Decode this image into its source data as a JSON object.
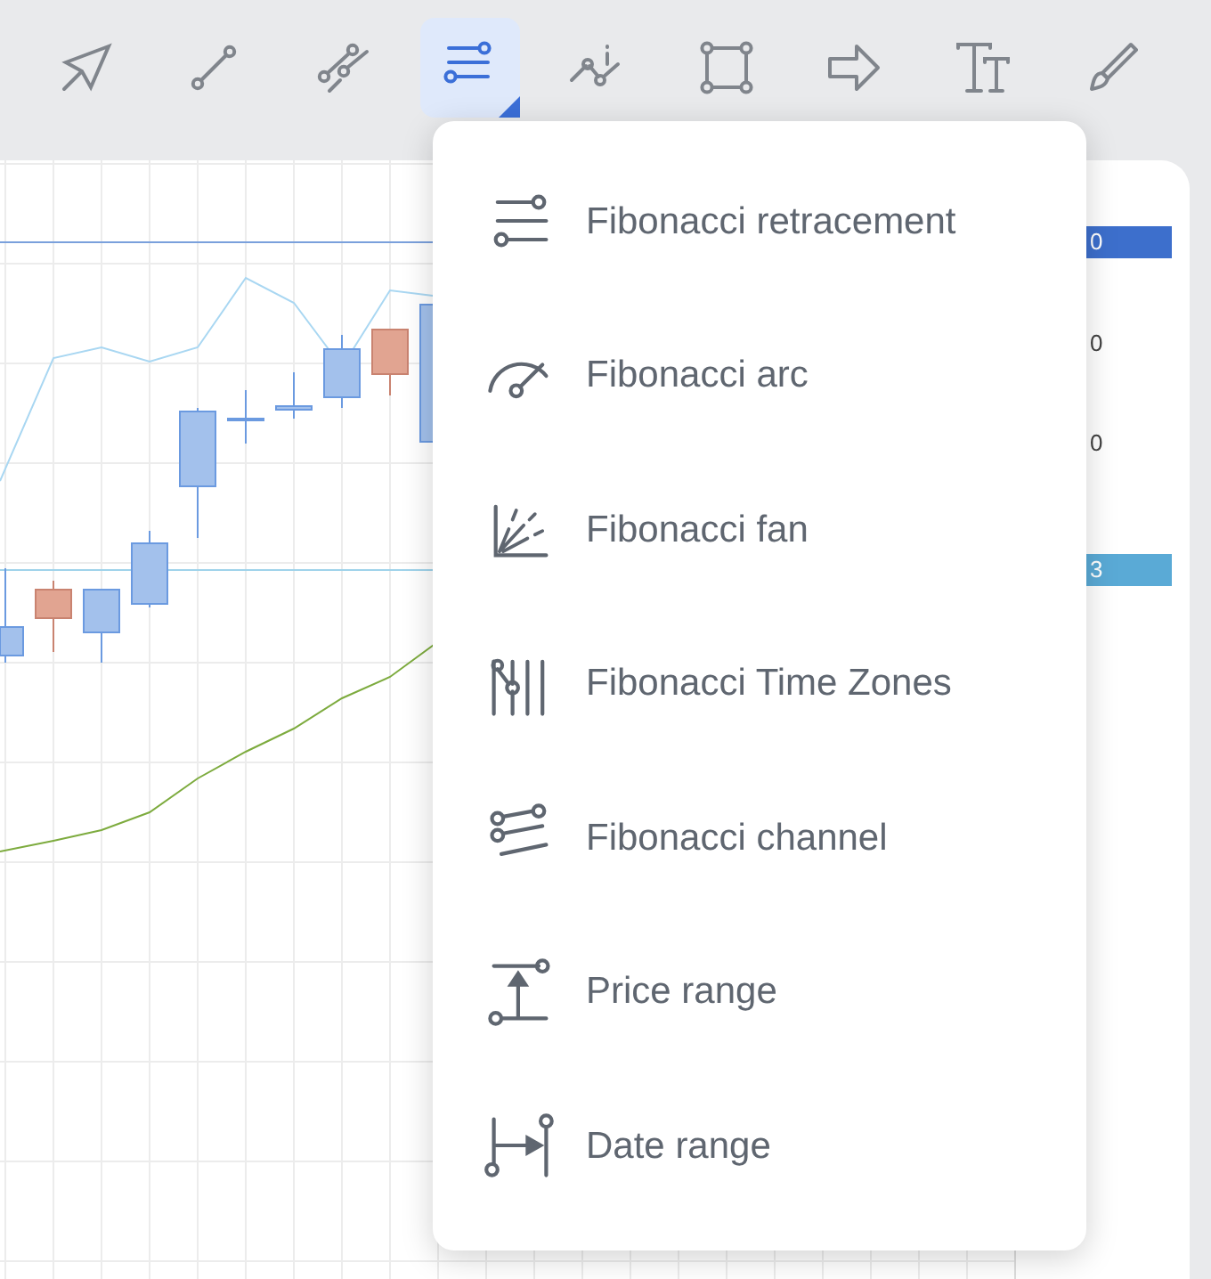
{
  "toolbar": [
    {
      "selected": false
    },
    {
      "selected": false
    },
    {
      "selected": false
    },
    {
      "selected": true
    },
    {
      "selected": false
    },
    {
      "selected": false
    },
    {
      "selected": false
    },
    {
      "selected": false
    },
    {
      "selected": false
    }
  ],
  "menu": {
    "items": [
      {
        "label": "Fibonacci retracement"
      },
      {
        "label": "Fibonacci arc"
      },
      {
        "label": "Fibonacci fan"
      },
      {
        "label": "Fibonacci Time Zones"
      },
      {
        "label": "Fibonacci channel"
      },
      {
        "label": "Price range"
      },
      {
        "label": "Date range"
      }
    ]
  },
  "price_axis": {
    "labels": [
      {
        "text": "0",
        "color": "#3d6fcc"
      },
      {
        "text": "0"
      },
      {
        "text": "0"
      },
      {
        "text": "3",
        "color": "#5aaad6"
      }
    ]
  }
}
